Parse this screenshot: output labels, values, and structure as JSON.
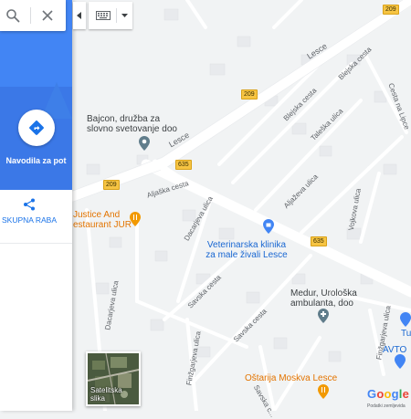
{
  "search": {
    "search_icon": "search-icon",
    "close_icon": "close-icon"
  },
  "panel": {
    "directions_label": "Navodila za pot",
    "directions_icon": "directions-icon",
    "share_label": "SKUPNA RABA",
    "share_icon": "share-icon",
    "accent_color": "#4285f4"
  },
  "controls": {
    "collapse_icon": "chevron-left-icon",
    "keyboard_icon": "keyboard-icon",
    "dropdown_icon": "caret-down-icon"
  },
  "map": {
    "road_labels": {
      "lesce_main": "Lesce",
      "lesce_left": "Lesce",
      "blejska_1": "Blejska cesta",
      "blejska_2": "Blejska cesta",
      "taleska": "Taleška ulica",
      "cesta_lipce": "Cesta na Lipce",
      "aljaska_1": "Aljaška cesta",
      "aljaska_2": "Aljaževa ulica",
      "vojkova": "Vojkova ulica",
      "dacarjeva_1": "Dacarjeva ulica",
      "dacarjeva_2": "Dacarjeva ulica",
      "savska_1": "Savska cesta",
      "savska_2": "Savska cesta",
      "savska_3": "Savska c...",
      "finzgarjeva_1": "Finžgarjeva ulica",
      "finzgarjeva_2": "Finžgarjeva ulica"
    },
    "shields": {
      "s209_top": "209",
      "s209_mid": "209",
      "s209_left": "209",
      "s635_a": "635",
      "s635_b": "635"
    },
    "pois": {
      "bajcon": "Bajcon, družba za\nslovno svetovanje doo",
      "justice": "Justice And\nestaurant JUR",
      "veterinarska": "Veterinarska klinika\nza male živali Lesce",
      "medur": "Medur, Urološka\nambulanta, doo",
      "avto": "AVTO",
      "tu": "Tu",
      "ostarija": "Oštarija Moskva Lesce"
    }
  },
  "satellite": {
    "label": "Satelitska\nslika"
  },
  "footer": {
    "logo": "Google",
    "logo_colors": [
      "#4285f4",
      "#ea4335",
      "#fbbc05",
      "#4285f4",
      "#34a853",
      "#ea4335"
    ],
    "attribution": "Podatki zemljevida"
  }
}
